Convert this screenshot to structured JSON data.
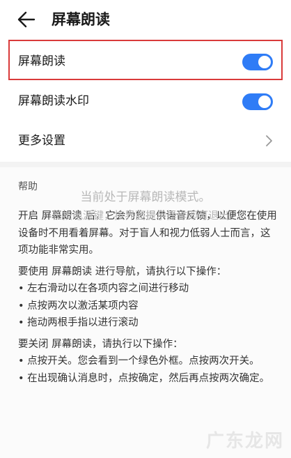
{
  "header": {
    "title": "屏幕朗读",
    "back_icon": "back-arrow-icon"
  },
  "settings": {
    "screen_reader": {
      "label": "屏幕朗读",
      "enabled": true
    },
    "watermark": {
      "label": "屏幕朗读水印",
      "enabled": true
    },
    "more": {
      "label": "更多设置",
      "icon": "chevron-right-icon"
    }
  },
  "colors": {
    "accent": "#2f7cf6",
    "highlight": "#d93a3a"
  },
  "help": {
    "title": "帮助",
    "intro": "开启 屏幕朗读 后，它会为您提供语音反馈，以便您在使用设备时不用看着屏幕。对于盲人和视力低弱人士而言，这项功能非常实用。",
    "nav_title": "要使用 屏幕朗读 进行导航，请执行以下操作：",
    "nav_items": [
      "• 左右滑动以在各项内容之间进行移动",
      "• 点按两次以激活某项内容",
      "• 拖动两根手指以进行滚动"
    ],
    "off_title": "要关闭 屏幕朗读，请执行以下操作：",
    "off_items": [
      "• 点按开关。您会看到一个绿色外框。点按两次开关。",
      "• 在出现确认消息时，点按确定，然后再点按两次确定。"
    ]
  },
  "overlay": {
    "line1": "当前处于屏幕朗读模式。",
    "line2": "长按电源键，按界面提示操作即可退出。"
  },
  "watermark_text": "广东龙网"
}
